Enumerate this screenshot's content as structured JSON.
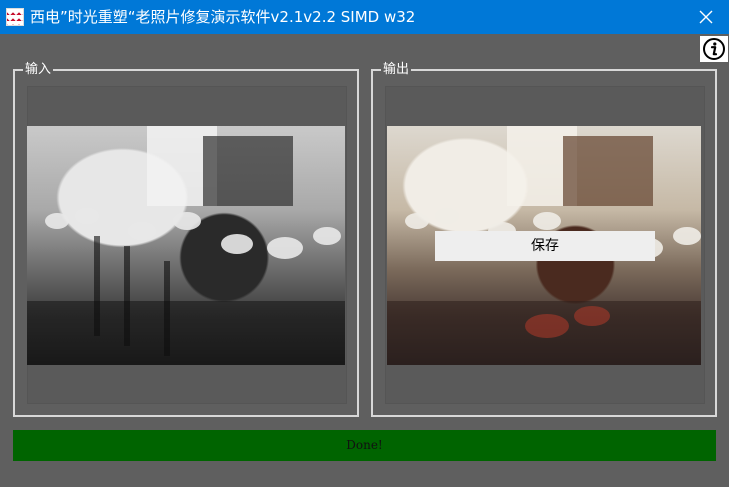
{
  "window": {
    "title": "西电”时光重塑“老照片修复演示软件v2.1v2.2 SIMD w32",
    "icons": {
      "app": "app-logo-icon",
      "close": "close-icon",
      "info": "info-icon"
    },
    "colors": {
      "titlebar": "#0078d7",
      "background": "#5f5f5f",
      "status_bg": "#006400"
    }
  },
  "panels": {
    "input": {
      "label": "输入",
      "image": "black-and-white-workshop-photo"
    },
    "output": {
      "label": "输出",
      "image": "colorized-workshop-photo"
    }
  },
  "actions": {
    "save_label": "保存"
  },
  "status": {
    "text": "Done!"
  }
}
